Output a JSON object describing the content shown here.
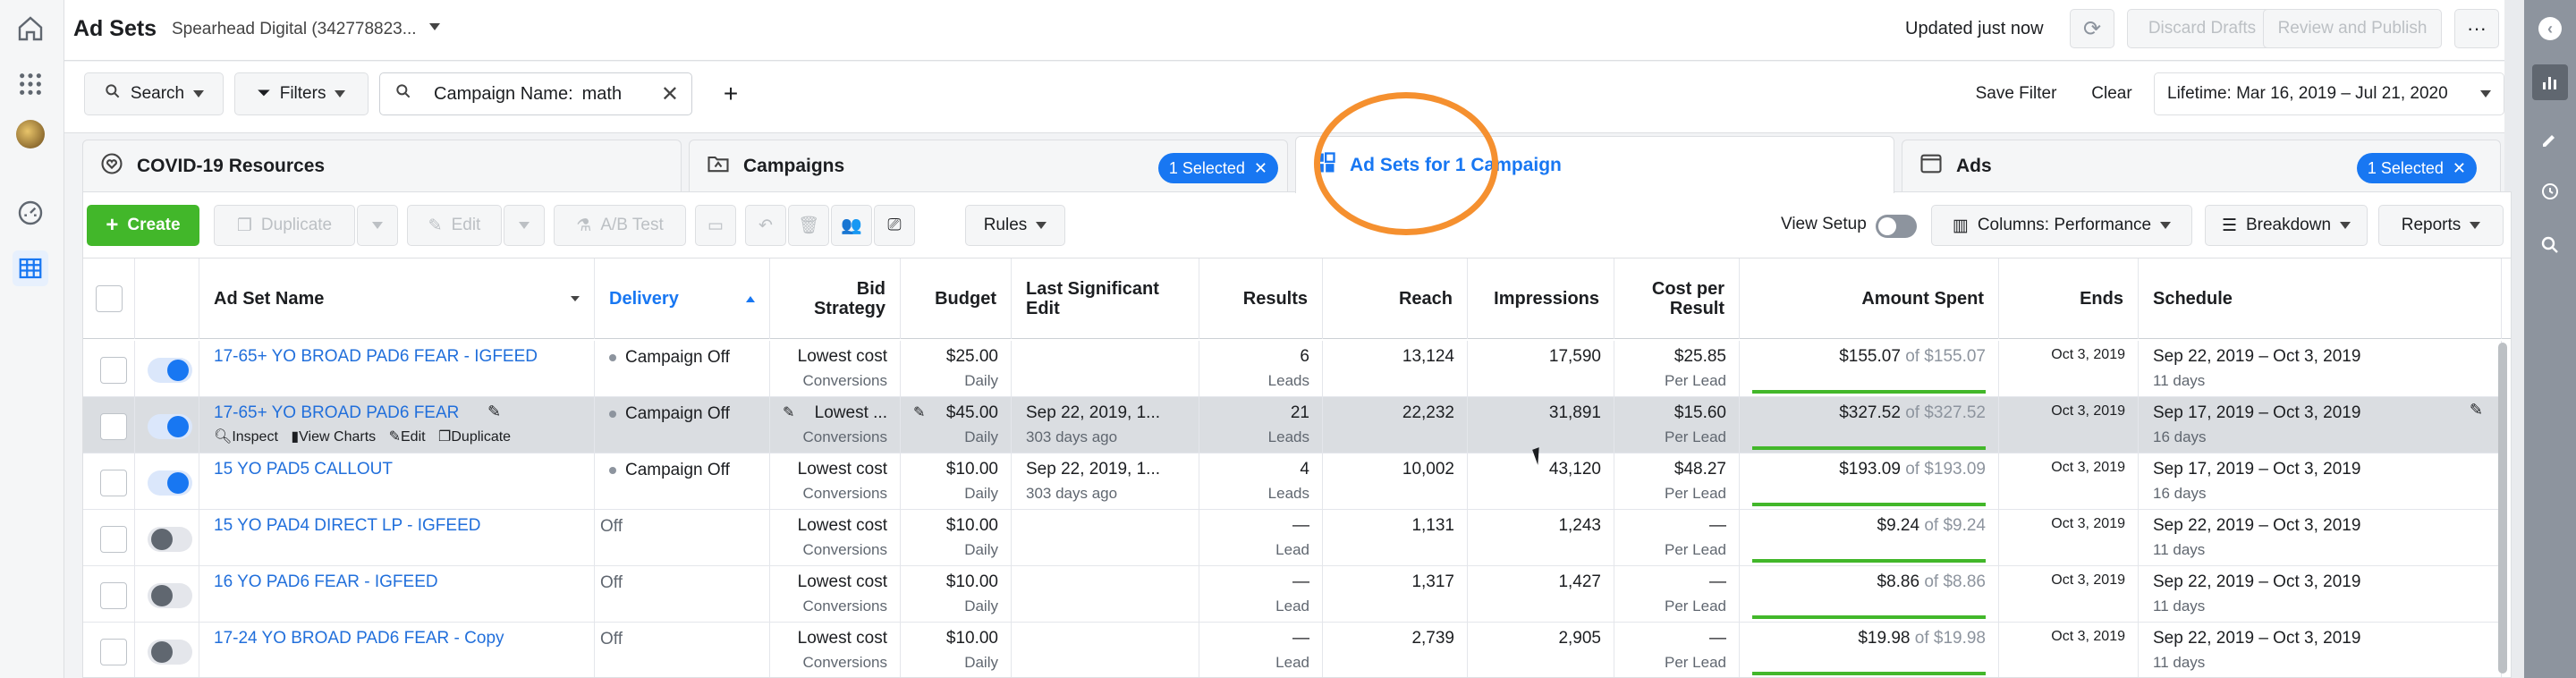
{
  "header": {
    "title": "Ad Sets",
    "account": "Spearhead Digital (342778823...",
    "updated": "Updated just now",
    "discard": "Discard Drafts",
    "review": "Review and Publish"
  },
  "filters": {
    "search": "Search",
    "filters": "Filters",
    "chip_label": "Campaign Name:",
    "chip_value": "math",
    "save": "Save Filter",
    "clear": "Clear",
    "date": "Lifetime: Mar 16, 2019 – Jul 21, 2020"
  },
  "tabs": {
    "covid": "COVID-19 Resources",
    "campaigns": "Campaigns",
    "campaigns_sel": "1 Selected",
    "adsets": "Ad Sets for 1 Campaign",
    "ads": "Ads",
    "ads_sel": "1 Selected"
  },
  "toolbar": {
    "create": "Create",
    "duplicate": "Duplicate",
    "edit": "Edit",
    "abtest": "A/B Test",
    "rules": "Rules",
    "view_setup": "View Setup",
    "columns": "Columns: Performance",
    "breakdown": "Breakdown",
    "reports": "Reports"
  },
  "columns": {
    "name": "Ad Set Name",
    "delivery": "Delivery",
    "bid1": "Bid",
    "bid2": "Strategy",
    "budget": "Budget",
    "last1": "Last Significant",
    "last2": "Edit",
    "results": "Results",
    "reach": "Reach",
    "impressions": "Impressions",
    "cpr1": "Cost per",
    "cpr2": "Result",
    "spent": "Amount Spent",
    "ends": "Ends",
    "schedule": "Schedule"
  },
  "hover_actions": {
    "inspect": "Inspect",
    "charts": "View Charts",
    "edit": "Edit",
    "duplicate": "Duplicate"
  },
  "rows": [
    {
      "name": "17-65+ YO BROAD PAD6 FEAR - IGFEED",
      "delivery": "Campaign Off",
      "bid": "Lowest cost",
      "bid_sub": "Conversions",
      "budget": "$25.00",
      "budget_sub": "Daily",
      "last": "",
      "last_sub": "",
      "results": "6",
      "results_sub": "Leads",
      "reach": "13,124",
      "impressions": "17,590",
      "cpr": "$25.85",
      "cpr_sub": "Per Lead",
      "spent": "$155.07",
      "spent_of": "of $155.07",
      "ends": "Oct 3, 2019",
      "schedule": "Sep 22, 2019 – Oct 3, 2019",
      "schedule_sub": "11 days"
    },
    {
      "name": "17-65+ YO BROAD PAD6 FEAR",
      "delivery": "Campaign Off",
      "bid": "Lowest ...",
      "bid_sub": "Conversions",
      "budget": "$45.00",
      "budget_sub": "Daily",
      "last": "Sep 22, 2019, 1...",
      "last_sub": "303 days ago",
      "results": "21",
      "results_sub": "Leads",
      "reach": "22,232",
      "impressions": "31,891",
      "cpr": "$15.60",
      "cpr_sub": "Per Lead",
      "spent": "$327.52",
      "spent_of": "of $327.52",
      "ends": "Oct 3, 2019",
      "schedule": "Sep 17, 2019 – Oct 3, 2019",
      "schedule_sub": "16 days"
    },
    {
      "name": "15 YO PAD5 CALLOUT",
      "delivery": "Campaign Off",
      "bid": "Lowest cost",
      "bid_sub": "Conversions",
      "budget": "$10.00",
      "budget_sub": "Daily",
      "last": "Sep 22, 2019, 1...",
      "last_sub": "303 days ago",
      "results": "4",
      "results_sub": "Leads",
      "reach": "10,002",
      "impressions": "43,120",
      "cpr": "$48.27",
      "cpr_sub": "Per Lead",
      "spent": "$193.09",
      "spent_of": "of $193.09",
      "ends": "Oct 3, 2019",
      "schedule": "Sep 17, 2019 – Oct 3, 2019",
      "schedule_sub": "16 days"
    },
    {
      "name": "15 YO PAD4 DIRECT LP - IGFEED",
      "delivery": "Off",
      "bid": "Lowest cost",
      "bid_sub": "Conversions",
      "budget": "$10.00",
      "budget_sub": "Daily",
      "last": "",
      "last_sub": "",
      "results": "—",
      "results_sub": "Lead",
      "reach": "1,131",
      "impressions": "1,243",
      "cpr": "—",
      "cpr_sub": "Per Lead",
      "spent": "$9.24",
      "spent_of": "of $9.24",
      "ends": "Oct 3, 2019",
      "schedule": "Sep 22, 2019 – Oct 3, 2019",
      "schedule_sub": "11 days"
    },
    {
      "name": "16 YO PAD6 FEAR - IGFEED",
      "delivery": "Off",
      "bid": "Lowest cost",
      "bid_sub": "Conversions",
      "budget": "$10.00",
      "budget_sub": "Daily",
      "last": "",
      "last_sub": "",
      "results": "—",
      "results_sub": "Lead",
      "reach": "1,317",
      "impressions": "1,427",
      "cpr": "—",
      "cpr_sub": "Per Lead",
      "spent": "$8.86",
      "spent_of": "of $8.86",
      "ends": "Oct 3, 2019",
      "schedule": "Sep 22, 2019 – Oct 3, 2019",
      "schedule_sub": "11 days"
    },
    {
      "name": "17-24 YO BROAD PAD6 FEAR - Copy",
      "delivery": "Off",
      "bid": "Lowest cost",
      "bid_sub": "Conversions",
      "budget": "$10.00",
      "budget_sub": "Daily",
      "last": "",
      "last_sub": "",
      "results": "—",
      "results_sub": "Lead",
      "reach": "2,739",
      "impressions": "2,905",
      "cpr": "—",
      "cpr_sub": "Per Lead",
      "spent": "$19.98",
      "spent_of": "of $19.98",
      "ends": "Oct 3, 2019",
      "schedule": "Sep 22, 2019 – Oct 3, 2019",
      "schedule_sub": "11 days"
    }
  ]
}
